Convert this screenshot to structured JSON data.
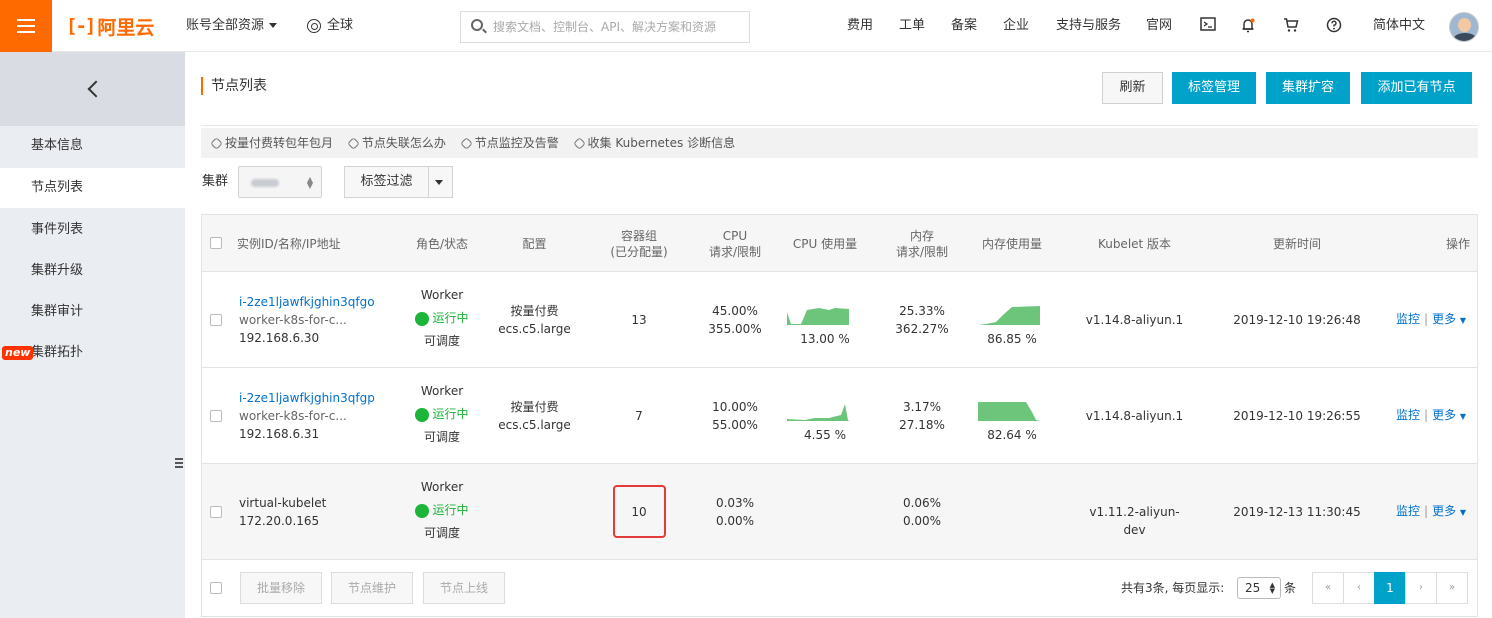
{
  "header": {
    "logo_text": "阿里云",
    "account_label": "账号全部资源",
    "region_label": "全球",
    "search_placeholder": "搜索文档、控制台、API、解决方案和资源",
    "nav": [
      "费用",
      "工单",
      "备案",
      "企业",
      "支持与服务",
      "官网"
    ],
    "language": "简体中文",
    "icons": [
      "terminal-icon",
      "bell-icon",
      "cart-icon",
      "help-icon"
    ]
  },
  "sidebar": {
    "items": [
      {
        "label": "基本信息"
      },
      {
        "label": "节点列表"
      },
      {
        "label": "事件列表"
      },
      {
        "label": "集群升级"
      },
      {
        "label": "集群审计"
      },
      {
        "label": "集群拓扑",
        "badge": "new"
      }
    ],
    "active_index": 1
  },
  "page": {
    "title": "节点列表",
    "buttons": {
      "refresh": "刷新",
      "tags": "标签管理",
      "scale": "集群扩容",
      "add_node": "添加已有节点"
    },
    "tips": [
      "按量付费转包年包月",
      "节点失联怎么办",
      "节点监控及告警",
      "收集 Kubernetes 诊断信息"
    ],
    "filter": {
      "cluster_label": "集群",
      "tag_filter_label": "标签过滤"
    }
  },
  "table": {
    "headers": {
      "instance": "实例ID/名称/IP地址",
      "role": "角色/状态",
      "config": "配置",
      "pods_line1": "容器组",
      "pods_line2": "(已分配量)",
      "cpu_line1": "CPU",
      "cpu_line2": "请求/限制",
      "cpu_usage": "CPU 使用量",
      "mem_line1": "内存",
      "mem_line2": "请求/限制",
      "mem_usage": "内存使用量",
      "kubelet": "Kubelet 版本",
      "updated": "更新时间",
      "actions": "操作"
    },
    "rows": [
      {
        "id": "i-2ze1ljawfkjghin3qfgo",
        "name": "worker-k8s-for-c...",
        "ip": "192.168.6.30",
        "role": "Worker",
        "status": "运行中",
        "schedulable": "可调度",
        "billing": "按量付费",
        "instance_type": "ecs.c5.large",
        "pods": "13",
        "cpu_request": "45.00%",
        "cpu_limit": "355.00%",
        "cpu_usage": "13.00 %",
        "mem_request": "25.33%",
        "mem_limit": "362.27%",
        "mem_usage": "86.85 %",
        "kubelet": "v1.14.8-aliyun.1",
        "updated": "2019-12-10 19:26:48",
        "monitor": "监控",
        "more": "更多"
      },
      {
        "id": "i-2ze1ljawfkjghin3qfgp",
        "name": "worker-k8s-for-c...",
        "ip": "192.168.6.31",
        "role": "Worker",
        "status": "运行中",
        "schedulable": "可调度",
        "billing": "按量付费",
        "instance_type": "ecs.c5.large",
        "pods": "7",
        "cpu_request": "10.00%",
        "cpu_limit": "55.00%",
        "cpu_usage": "4.55 %",
        "mem_request": "3.17%",
        "mem_limit": "27.18%",
        "mem_usage": "82.64 %",
        "kubelet": "v1.14.8-aliyun.1",
        "updated": "2019-12-10 19:26:55",
        "monitor": "监控",
        "more": "更多"
      },
      {
        "id": "",
        "name": "virtual-kubelet",
        "ip": "172.20.0.165",
        "role": "Worker",
        "status": "运行中",
        "schedulable": "可调度",
        "billing": "",
        "instance_type": "",
        "pods": "10",
        "cpu_request": "0.03%",
        "cpu_limit": "0.00%",
        "cpu_usage": "",
        "mem_request": "0.06%",
        "mem_limit": "0.00%",
        "mem_usage": "",
        "kubelet": "v1.11.2-aliyun-dev",
        "updated": "2019-12-13 11:30:45",
        "monitor": "监控",
        "more": "更多"
      }
    ],
    "footer": {
      "batch_remove": "批量移除",
      "maintain": "节点维护",
      "online": "节点上线",
      "total_text": "共有3条, 每页显示:",
      "page_size": "25",
      "unit": "条",
      "current_page": "1",
      "first": "«",
      "prev": "‹",
      "next": "›",
      "last": "»"
    }
  },
  "colors": {
    "brand": "#ff6a00",
    "primary_button": "#00a2ca",
    "running": "#1cb53a",
    "highlight_box": "#e23b3b",
    "sparkline": "#5dbf6e"
  }
}
